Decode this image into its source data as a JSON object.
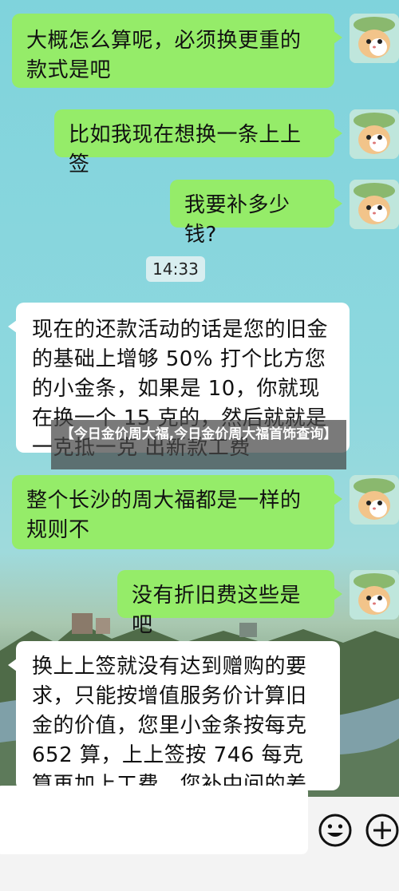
{
  "banner": {
    "text": "【今日金价周大福,今日金价周大福首饰查询】"
  },
  "timestamp": "14:33",
  "messages": [
    {
      "side": "right",
      "text": "大概怎么算呢，必须换更重的款式是吧"
    },
    {
      "side": "right",
      "text": "比如我现在想换一条上上签"
    },
    {
      "side": "right",
      "text": "我要补多少钱?"
    },
    {
      "side": "left",
      "text": "现在的还款活动的话是您的旧金的基础上增够 50% 打个比方您的小金条，如果是 10，你就现在换一个 15 克的，然后就就是一克抵一克 出新款工费"
    },
    {
      "side": "right",
      "text": "整个长沙的周大福都是一样的规则不"
    },
    {
      "side": "right",
      "text": "没有折旧费这些是吧"
    },
    {
      "side": "left",
      "text": "换上上签就没有达到赠购的要求，只能按增值服务价计算旧金的价值，您里小金条按每克 652 算，上上签按 746 每克算再加上工费，您补中间的差价"
    }
  ],
  "input": {
    "value": ""
  },
  "icons": {
    "emoji": "emoji-icon",
    "add": "plus-icon",
    "avatar": "cat-avatar-icon"
  },
  "colors": {
    "sent_bubble": "#95ec69",
    "received_bubble": "#ffffff"
  }
}
